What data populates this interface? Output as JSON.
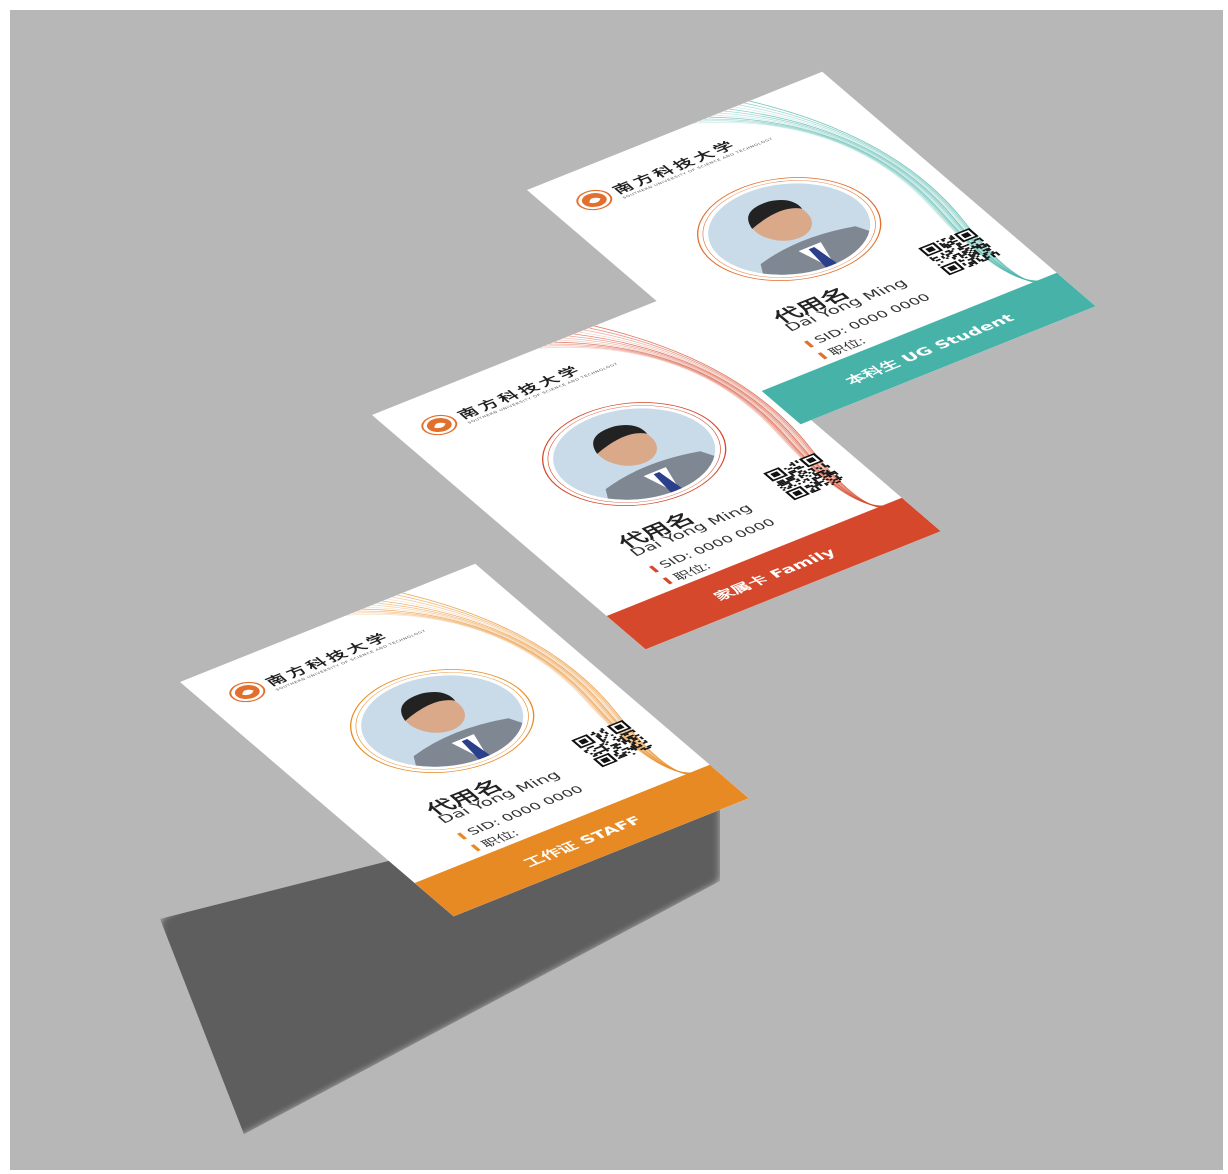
{
  "cards": [
    {
      "id": "staff",
      "university_name": "南方科技大学",
      "university_subtitle": "SOUTHERN UNIVERSITY OF SCIENCE AND TECHNOLOGY",
      "name_cn": "代用名",
      "name_en": "Dai Yong Ming",
      "sid": "SID: 0000 0000",
      "position": "职位:",
      "footer_label": "工作证  STAFF",
      "accent": "#e88a23"
    },
    {
      "id": "family",
      "university_name": "南方科技大学",
      "university_subtitle": "SOUTHERN UNIVERSITY OF SCIENCE AND TECHNOLOGY",
      "name_cn": "代用名",
      "name_en": "Dai Yong Ming",
      "sid": "SID: 0000 0000",
      "position": "职位:",
      "footer_label": "家属卡  Family",
      "accent": "#d5482b"
    },
    {
      "id": "student",
      "university_name": "南方科技大学",
      "university_subtitle": "SOUTHERN UNIVERSITY OF SCIENCE AND TECHNOLOGY",
      "name_cn": "代用名",
      "name_en": "Dai Yong Ming",
      "sid": "SID: 0000 0000",
      "position": "职位:",
      "footer_label": "本科生  UG Student",
      "accent": "#47b3a8"
    }
  ],
  "colors": {
    "background": "#b7b7b7",
    "shadow": "#5c5c5c",
    "seal": "#e36f2d"
  }
}
